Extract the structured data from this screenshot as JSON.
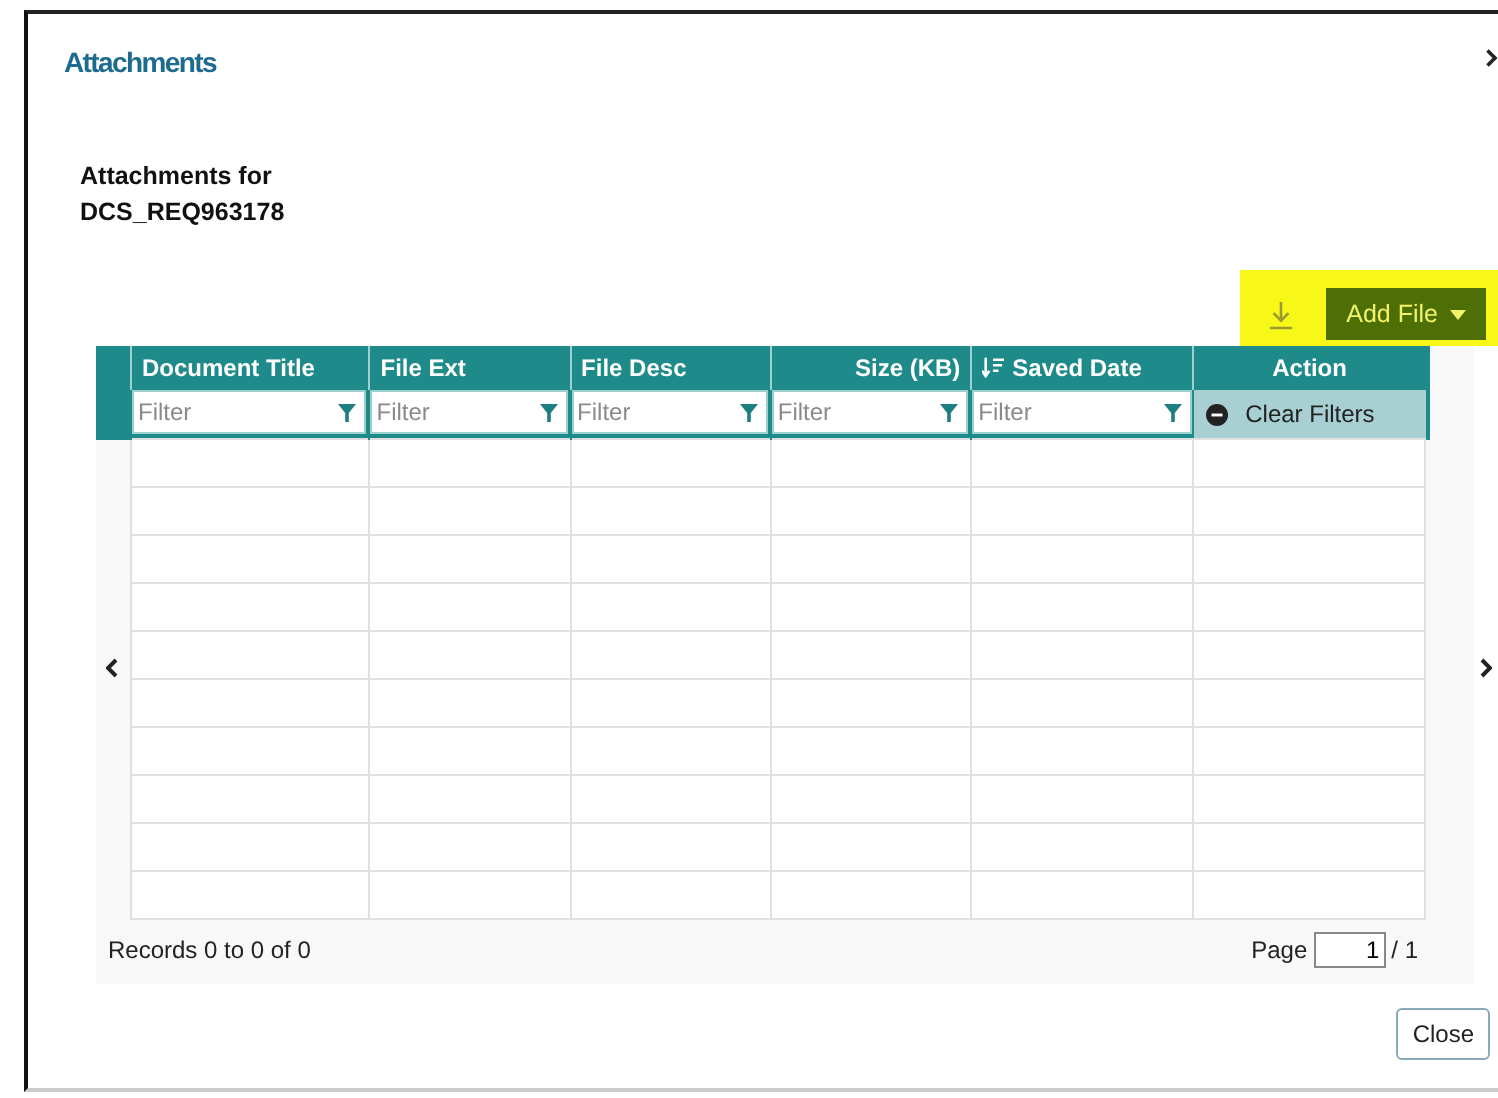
{
  "dialog": {
    "title": "Attachments",
    "subtitle_lines": [
      "Attachments for",
      "DCS_REQ963178"
    ]
  },
  "toolbar": {
    "add_button": "Add File",
    "highlighted": true
  },
  "table": {
    "columns": [
      {
        "label": "Document Title",
        "sorted": false
      },
      {
        "label": "File Ext",
        "sorted": false
      },
      {
        "label": "File Desc",
        "sorted": false
      },
      {
        "label": "Size (KB)",
        "sorted": false
      },
      {
        "label": "Saved Date",
        "sorted": true
      },
      {
        "label": "Action",
        "sorted": false
      }
    ],
    "filters": [
      {
        "placeholder": "Filter"
      },
      {
        "placeholder": "Filter"
      },
      {
        "placeholder": "Filter"
      },
      {
        "placeholder": "Filter"
      },
      {
        "placeholder": "Filter"
      }
    ],
    "clear_filters": "Clear Filters"
  },
  "footer": {
    "records": "Records 0 to 0 of 0",
    "page_label": "Page",
    "page_value": "1",
    "page_total": "/ 1"
  },
  "buttons": [
    "Close"
  ]
}
